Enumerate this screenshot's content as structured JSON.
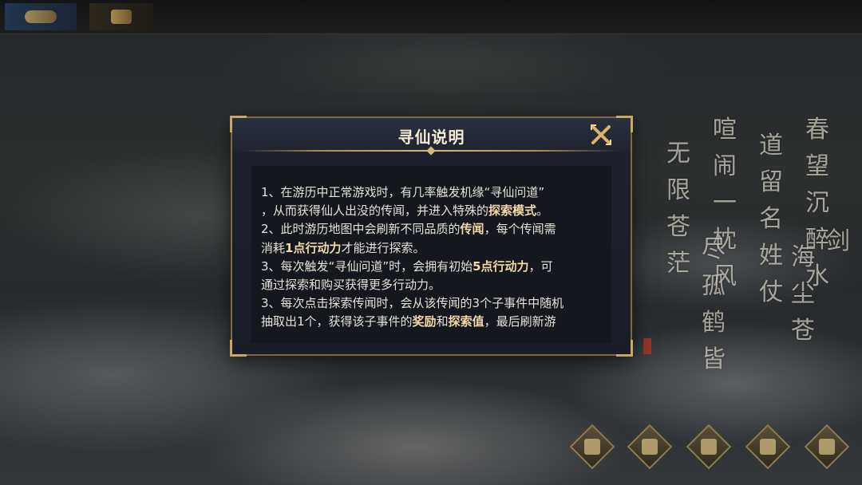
{
  "dialog": {
    "title": "寻仙说明",
    "rules": [
      {
        "parts": [
          {
            "t": "1、在游历中正常游戏时，有几率触发机缘“寻仙问道”",
            "hl": false
          }
        ]
      },
      {
        "parts": [
          {
            "t": "，从而获得仙人出没的传闻，并进入特殊的",
            "hl": false
          },
          {
            "t": "探索模式",
            "hl": true
          },
          {
            "t": "。",
            "hl": false
          }
        ]
      },
      {
        "parts": [
          {
            "t": "2、此时游历地图中会刷新不同品质的",
            "hl": false
          },
          {
            "t": "传闻",
            "hl": true
          },
          {
            "t": "，每个传闻需",
            "hl": false
          }
        ]
      },
      {
        "parts": [
          {
            "t": "消耗",
            "hl": false
          },
          {
            "t": "1点行动力",
            "hl": true
          },
          {
            "t": "才能进行探索。",
            "hl": false
          }
        ]
      },
      {
        "parts": [
          {
            "t": "3、每次触发“寻仙问道”时，会拥有初始",
            "hl": false
          },
          {
            "t": "5点行动力",
            "hl": true
          },
          {
            "t": "，可",
            "hl": false
          }
        ]
      },
      {
        "parts": [
          {
            "t": "通过探索和购买获得更多行动力。",
            "hl": false
          }
        ]
      },
      {
        "parts": [
          {
            "t": "3、每次点击探索传闻时，会从该传闻的3个子事件中随机",
            "hl": false
          }
        ]
      },
      {
        "parts": [
          {
            "t": "抽取出1个，获得该子事件的",
            "hl": false
          },
          {
            "t": "奖励",
            "hl": true
          },
          {
            "t": "和",
            "hl": false
          },
          {
            "t": "探索值",
            "hl": true
          },
          {
            "t": "，最后刷新游",
            "hl": false
          }
        ]
      }
    ]
  },
  "calligraphy": {
    "columns": [
      "春望沉醉水",
      "道留名姓仗",
      "喧闹一枕风",
      "无限苍茫",
      "尽孤鹤皆",
      "海尘苍",
      "剑"
    ],
    "color": "#dcd6c6"
  },
  "icons": {
    "close": "close-x-icon",
    "bottom_buttons": [
      "compass-icon",
      "character-icon",
      "chest-icon",
      "bag-icon",
      "scroll-icon"
    ]
  },
  "colors": {
    "gold": "#c9a664",
    "highlight": "#f2d9a6",
    "text": "#e6e2d8",
    "panel": "#1a1d27"
  }
}
